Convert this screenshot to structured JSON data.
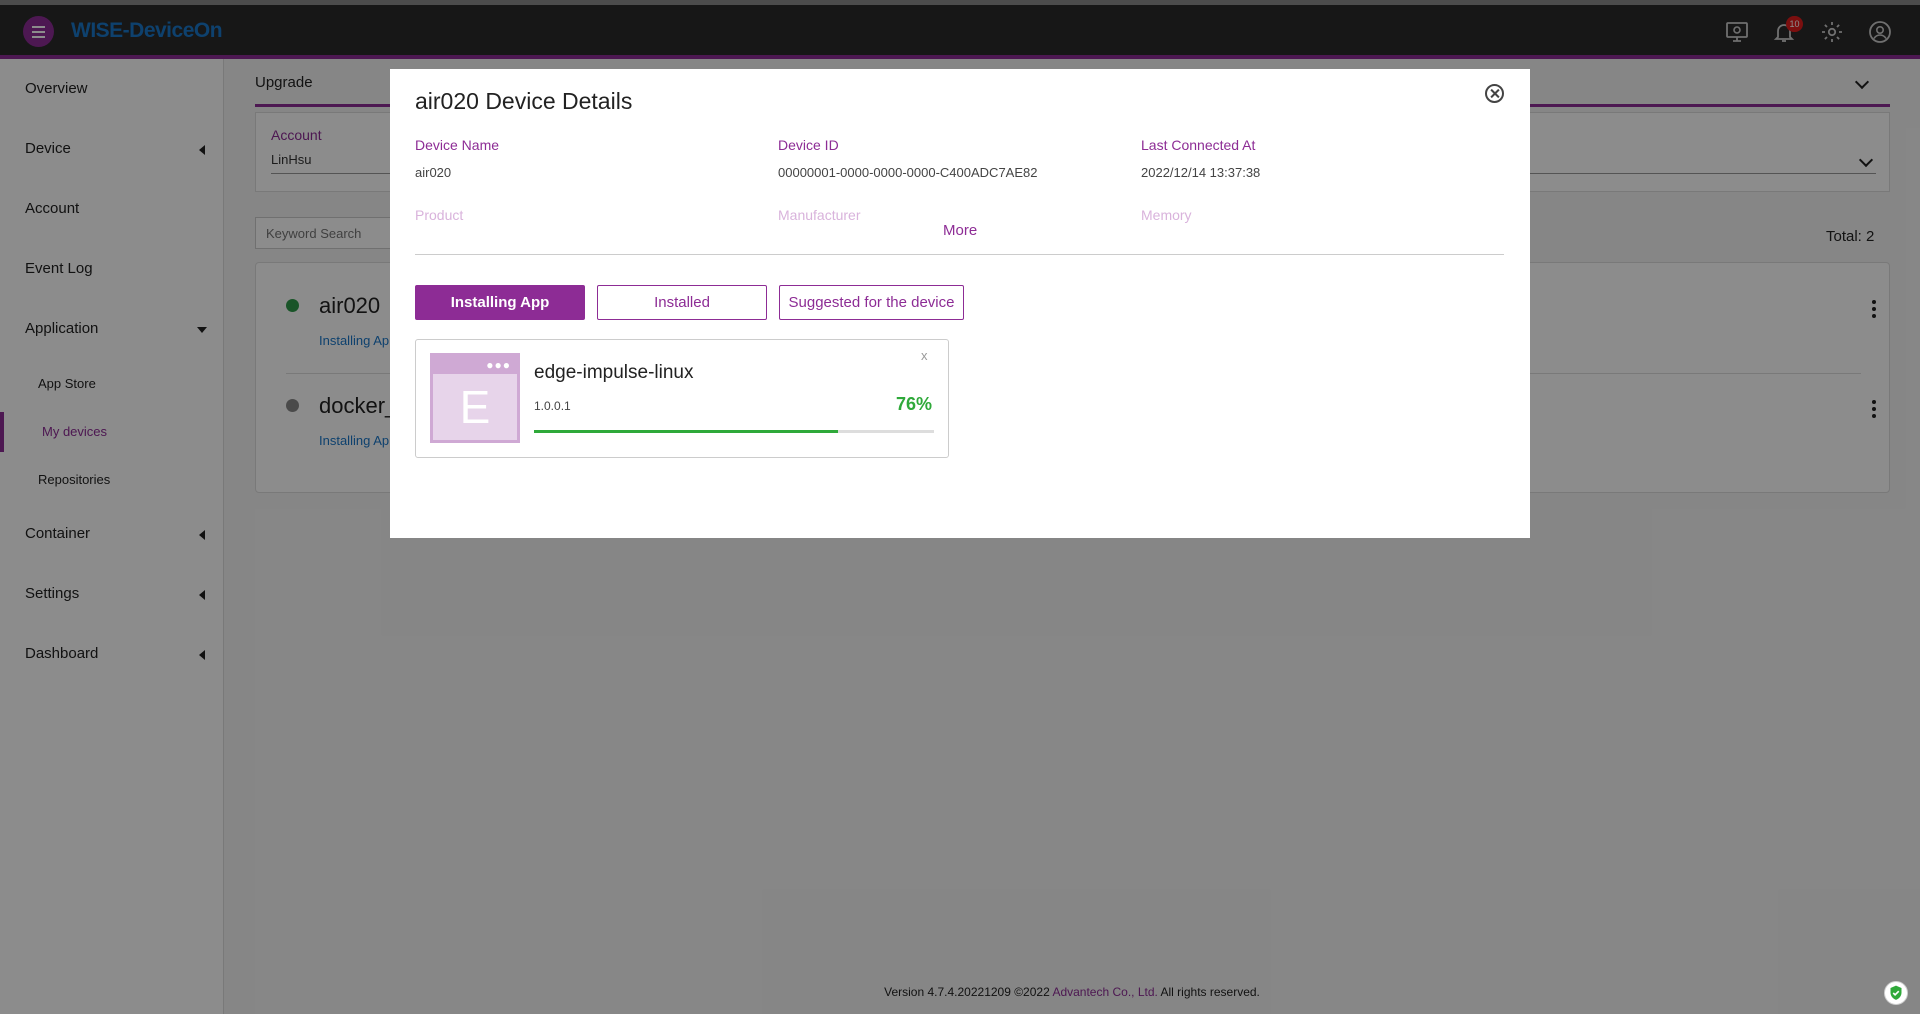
{
  "app": {
    "brand": "WISE-DeviceOn",
    "notification_count": "10"
  },
  "colors": {
    "accent": "#8d2c95",
    "link": "#1a77c9",
    "success": "#2fa93a"
  },
  "sidebar": {
    "items": [
      {
        "label": "Overview"
      },
      {
        "label": "Device"
      },
      {
        "label": "Account"
      },
      {
        "label": "Event Log"
      },
      {
        "label": "Application"
      },
      {
        "label": "Container"
      },
      {
        "label": "Settings"
      },
      {
        "label": "Dashboard"
      }
    ],
    "sub_items": [
      {
        "label": "App Store"
      },
      {
        "label": "My devices"
      },
      {
        "label": "Repositories"
      }
    ]
  },
  "main": {
    "upgrade_label": "Upgrade",
    "filter": {
      "account_label": "Account",
      "account_value": "LinHsu"
    },
    "search_placeholder": "Keyword Search",
    "total": "Total: 2",
    "devices": [
      {
        "name": "air020",
        "status": "Installing Ap"
      },
      {
        "name": "docker_",
        "status": "Installing Ap"
      }
    ]
  },
  "modal": {
    "title": "air020 Device Details",
    "fields": {
      "device_name_label": "Device Name",
      "device_name_value": "air020",
      "device_id_label": "Device ID",
      "device_id_value": "00000001-0000-0000-0000-C400ADC7AE82",
      "last_connected_label": "Last Connected At",
      "last_connected_value": "2022/12/14 13:37:38",
      "product_label": "Product",
      "manufacturer_label": "Manufacturer",
      "memory_label": "Memory"
    },
    "more_label": "More",
    "tabs": [
      {
        "label": "Installing App",
        "active": true
      },
      {
        "label": "Installed",
        "active": false
      },
      {
        "label": "Suggested for the device",
        "active": false
      }
    ],
    "app_card": {
      "icon_letter": "E",
      "name": "edge-impulse-linux",
      "version": "1.0.0.1",
      "progress_percent": 76,
      "progress_label": "76%",
      "close_label": "x"
    }
  },
  "footer": {
    "version": "Version 4.7.4.20221209 ©2022",
    "company": "Advantech Co., Ltd.",
    "rights": "All rights reserved."
  }
}
